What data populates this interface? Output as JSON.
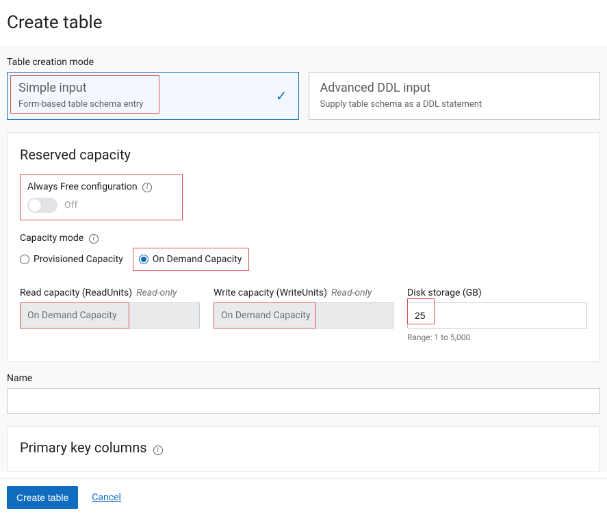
{
  "page": {
    "title": "Create table"
  },
  "mode": {
    "label": "Table creation mode",
    "simple": {
      "title": "Simple input",
      "desc": "Form-based table schema entry"
    },
    "advanced": {
      "title": "Advanced DDL input",
      "desc": "Supply table schema as a DDL statement"
    }
  },
  "reserved": {
    "title": "Reserved capacity",
    "alwaysFree": {
      "label": "Always Free configuration",
      "state": "Off"
    },
    "capacityMode": {
      "label": "Capacity mode",
      "provisioned": "Provisioned Capacity",
      "onDemand": "On Demand Capacity"
    },
    "readCap": {
      "label": "Read capacity (ReadUnits)",
      "ro": "Read-only",
      "value": "On Demand Capacity"
    },
    "writeCap": {
      "label": "Write capacity (WriteUnits)",
      "ro": "Read-only",
      "value": "On Demand Capacity"
    },
    "disk": {
      "label": "Disk storage (GB)",
      "value": "25",
      "range": "Range: 1 to 5,000"
    }
  },
  "name": {
    "label": "Name",
    "value": ""
  },
  "pk": {
    "title": "Primary key columns"
  },
  "footer": {
    "create": "Create table",
    "cancel": "Cancel"
  }
}
